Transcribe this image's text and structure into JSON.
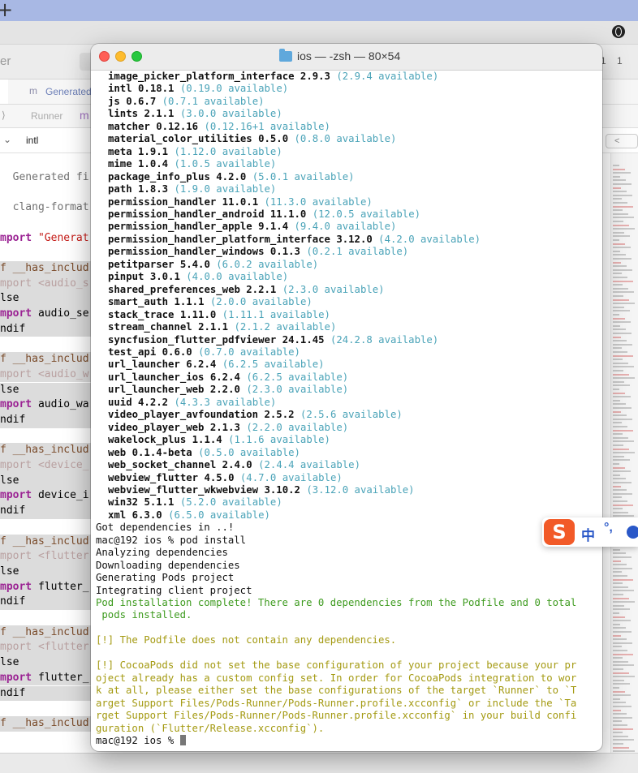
{
  "background_app": {
    "title_fragment": "er",
    "counts": [
      "1",
      "1"
    ],
    "tab_label": "Generated",
    "breadcrumb": [
      "Runner",
      "m"
    ],
    "jump_label": "intl",
    "code_lines": [
      {
        "type": "blank",
        "text": ""
      },
      {
        "type": "comment",
        "text": "  Generated fi"
      },
      {
        "type": "blank",
        "text": ""
      },
      {
        "type": "comment",
        "text": "  clang-format"
      },
      {
        "type": "blank",
        "text": ""
      },
      {
        "type": "import",
        "kw": "mport",
        "text": " \"Generat"
      },
      {
        "type": "blank",
        "text": ""
      },
      {
        "type": "if",
        "text": "f __has_includ"
      },
      {
        "type": "dimimport",
        "text": "mport <audio_s"
      },
      {
        "type": "plain",
        "text": "lse"
      },
      {
        "type": "kwimport",
        "kw": "mport",
        "text": " audio_se"
      },
      {
        "type": "plain",
        "text": "ndif"
      },
      {
        "type": "blank",
        "text": ""
      },
      {
        "type": "if",
        "text": "f __has_includ"
      },
      {
        "type": "dimimport",
        "text": "mport <audio_w"
      },
      {
        "type": "plain",
        "text": "lse"
      },
      {
        "type": "kwimport",
        "kw": "mport",
        "text": " audio_wa"
      },
      {
        "type": "plain",
        "text": "ndif"
      },
      {
        "type": "blank",
        "text": ""
      },
      {
        "type": "if",
        "text": "f __has_includ"
      },
      {
        "type": "dimimport",
        "text": "mport <device_"
      },
      {
        "type": "plain",
        "text": "lse"
      },
      {
        "type": "kwimport",
        "kw": "mport",
        "text": " device_i"
      },
      {
        "type": "plain",
        "text": "ndif"
      },
      {
        "type": "blank",
        "text": ""
      },
      {
        "type": "if",
        "text": "f __has_includ"
      },
      {
        "type": "dimimport",
        "text": "mport <flutter"
      },
      {
        "type": "plain",
        "text": "lse"
      },
      {
        "type": "kwimport",
        "kw": "mport",
        "text": " flutter_"
      },
      {
        "type": "plain",
        "text": "ndif"
      },
      {
        "type": "blank",
        "text": ""
      },
      {
        "type": "if",
        "text": "f __has_includ"
      },
      {
        "type": "dimimport",
        "text": "mport <flutter"
      },
      {
        "type": "plain",
        "text": "lse"
      },
      {
        "type": "kwimport",
        "kw": "mport",
        "text": " flutter_"
      },
      {
        "type": "plain",
        "text": "ndif"
      },
      {
        "type": "blank",
        "text": ""
      },
      {
        "type": "if",
        "text": "f __has_includ"
      }
    ]
  },
  "terminal": {
    "title": "ios — -zsh — 80×54",
    "packages": [
      {
        "name": "image_picker_platform_interface",
        "version": "2.9.3",
        "available": "(2.9.4 available)"
      },
      {
        "name": "intl",
        "version": "0.18.1",
        "available": "(0.19.0 available)"
      },
      {
        "name": "js",
        "version": "0.6.7",
        "available": "(0.7.1 available)"
      },
      {
        "name": "lints",
        "version": "2.1.1",
        "available": "(3.0.0 available)"
      },
      {
        "name": "matcher",
        "version": "0.12.16",
        "available": "(0.12.16+1 available)"
      },
      {
        "name": "material_color_utilities",
        "version": "0.5.0",
        "available": "(0.8.0 available)"
      },
      {
        "name": "meta",
        "version": "1.9.1",
        "available": "(1.12.0 available)"
      },
      {
        "name": "mime",
        "version": "1.0.4",
        "available": "(1.0.5 available)"
      },
      {
        "name": "package_info_plus",
        "version": "4.2.0",
        "available": "(5.0.1 available)"
      },
      {
        "name": "path",
        "version": "1.8.3",
        "available": "(1.9.0 available)"
      },
      {
        "name": "permission_handler",
        "version": "11.0.1",
        "available": "(11.3.0 available)"
      },
      {
        "name": "permission_handler_android",
        "version": "11.1.0",
        "available": "(12.0.5 available)"
      },
      {
        "name": "permission_handler_apple",
        "version": "9.1.4",
        "available": "(9.4.0 available)"
      },
      {
        "name": "permission_handler_platform_interface",
        "version": "3.12.0",
        "available": "(4.2.0 available)"
      },
      {
        "name": "permission_handler_windows",
        "version": "0.1.3",
        "available": "(0.2.1 available)"
      },
      {
        "name": "petitparser",
        "version": "5.4.0",
        "available": "(6.0.2 available)"
      },
      {
        "name": "pinput",
        "version": "3.0.1",
        "available": "(4.0.0 available)"
      },
      {
        "name": "shared_preferences_web",
        "version": "2.2.1",
        "available": "(2.3.0 available)"
      },
      {
        "name": "smart_auth",
        "version": "1.1.1",
        "available": "(2.0.0 available)"
      },
      {
        "name": "stack_trace",
        "version": "1.11.0",
        "available": "(1.11.1 available)"
      },
      {
        "name": "stream_channel",
        "version": "2.1.1",
        "available": "(2.1.2 available)"
      },
      {
        "name": "syncfusion_flutter_pdfviewer",
        "version": "24.1.45",
        "available": "(24.2.8 available)"
      },
      {
        "name": "test_api",
        "version": "0.6.0",
        "available": "(0.7.0 available)"
      },
      {
        "name": "url_launcher",
        "version": "6.2.4",
        "available": "(6.2.5 available)"
      },
      {
        "name": "url_launcher_ios",
        "version": "6.2.4",
        "available": "(6.2.5 available)"
      },
      {
        "name": "url_launcher_web",
        "version": "2.2.0",
        "available": "(2.3.0 available)"
      },
      {
        "name": "uuid",
        "version": "4.2.2",
        "available": "(4.3.3 available)"
      },
      {
        "name": "video_player_avfoundation",
        "version": "2.5.2",
        "available": "(2.5.6 available)"
      },
      {
        "name": "video_player_web",
        "version": "2.1.3",
        "available": "(2.2.0 available)"
      },
      {
        "name": "wakelock_plus",
        "version": "1.1.4",
        "available": "(1.1.6 available)"
      },
      {
        "name": "web",
        "version": "0.1.4-beta",
        "available": "(0.5.0 available)"
      },
      {
        "name": "web_socket_channel",
        "version": "2.4.0",
        "available": "(2.4.4 available)"
      },
      {
        "name": "webview_flutter",
        "version": "4.5.0",
        "available": "(4.7.0 available)"
      },
      {
        "name": "webview_flutter_wkwebview",
        "version": "3.10.2",
        "available": "(3.12.0 available)"
      },
      {
        "name": "win32",
        "version": "5.1.1",
        "available": "(5.2.0 available)"
      },
      {
        "name": "xml",
        "version": "6.3.0",
        "available": "(6.5.0 available)"
      }
    ],
    "output_lines": [
      {
        "style": "plain",
        "text": "Got dependencies in ..!"
      },
      {
        "style": "plain",
        "text": "mac@192 ios % pod install"
      },
      {
        "style": "plain",
        "text": "Analyzing dependencies"
      },
      {
        "style": "plain",
        "text": "Downloading dependencies"
      },
      {
        "style": "plain",
        "text": "Generating Pods project"
      },
      {
        "style": "plain",
        "text": "Integrating client project"
      },
      {
        "style": "green",
        "text": "Pod installation complete! There are 0 dependencies from the Podfile and 0 total"
      },
      {
        "style": "green",
        "text": " pods installed."
      },
      {
        "style": "plain",
        "text": ""
      },
      {
        "style": "olive",
        "text": "[!] The Podfile does not contain any dependencies."
      },
      {
        "style": "plain",
        "text": ""
      },
      {
        "style": "olive",
        "text": "[!] CocoaPods did not set the base configuration of your project because your pr"
      },
      {
        "style": "olive",
        "text": "oject already has a custom config set. In order for CocoaPods integration to wor"
      },
      {
        "style": "olive",
        "text": "k at all, please either set the base configurations of the target `Runner` to `T"
      },
      {
        "style": "olive",
        "text": "arget Support Files/Pods-Runner/Pods-Runner.profile.xcconfig` or include the `Ta"
      },
      {
        "style": "olive",
        "text": "rget Support Files/Pods-Runner/Pods-Runner.profile.xcconfig` in your build confi"
      },
      {
        "style": "olive",
        "text": "guration (`Flutter/Release.xcconfig`)."
      }
    ],
    "prompt": "mac@192 ios % "
  },
  "ime": {
    "logo": "S",
    "mode": "中",
    "punct": "°,"
  },
  "colors": {
    "available": "#4aa3b8",
    "success": "#3e9b1f",
    "warning": "#a49a12",
    "close": "#ff5f57",
    "minimize": "#febc2e",
    "zoom": "#28c840"
  }
}
